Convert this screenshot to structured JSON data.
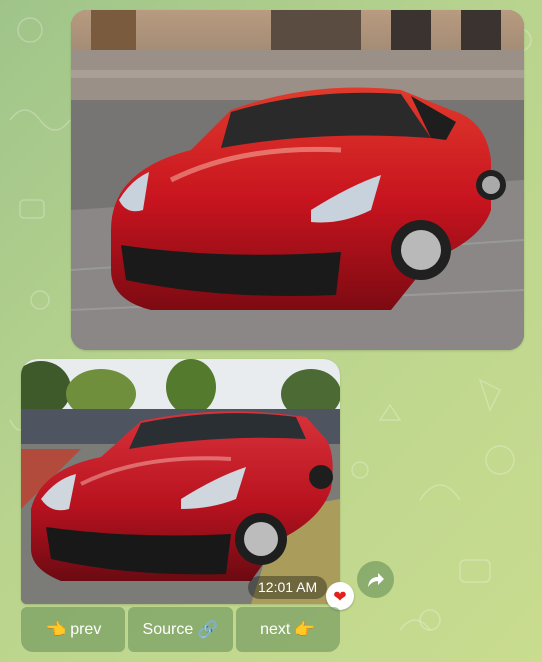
{
  "chat": {
    "photos": [
      {
        "subject": "red sports car in front of stone building"
      },
      {
        "subject": "red sports car parked outdoors with people and trees"
      }
    ],
    "message_time": "12:01 AM",
    "reaction": "❤",
    "share_icon": "share-arrow-icon"
  },
  "keyboard": {
    "buttons": [
      {
        "label": "prev",
        "emoji_before": "👈"
      },
      {
        "label": "Source",
        "emoji_after": "🔗"
      },
      {
        "label": "next",
        "emoji_after": "👉"
      }
    ]
  },
  "colors": {
    "wallpaper_start": "#9fc48a",
    "wallpaper_end": "#c9dc8f",
    "car_red": "#c8141f",
    "heart": "#e2211c"
  }
}
